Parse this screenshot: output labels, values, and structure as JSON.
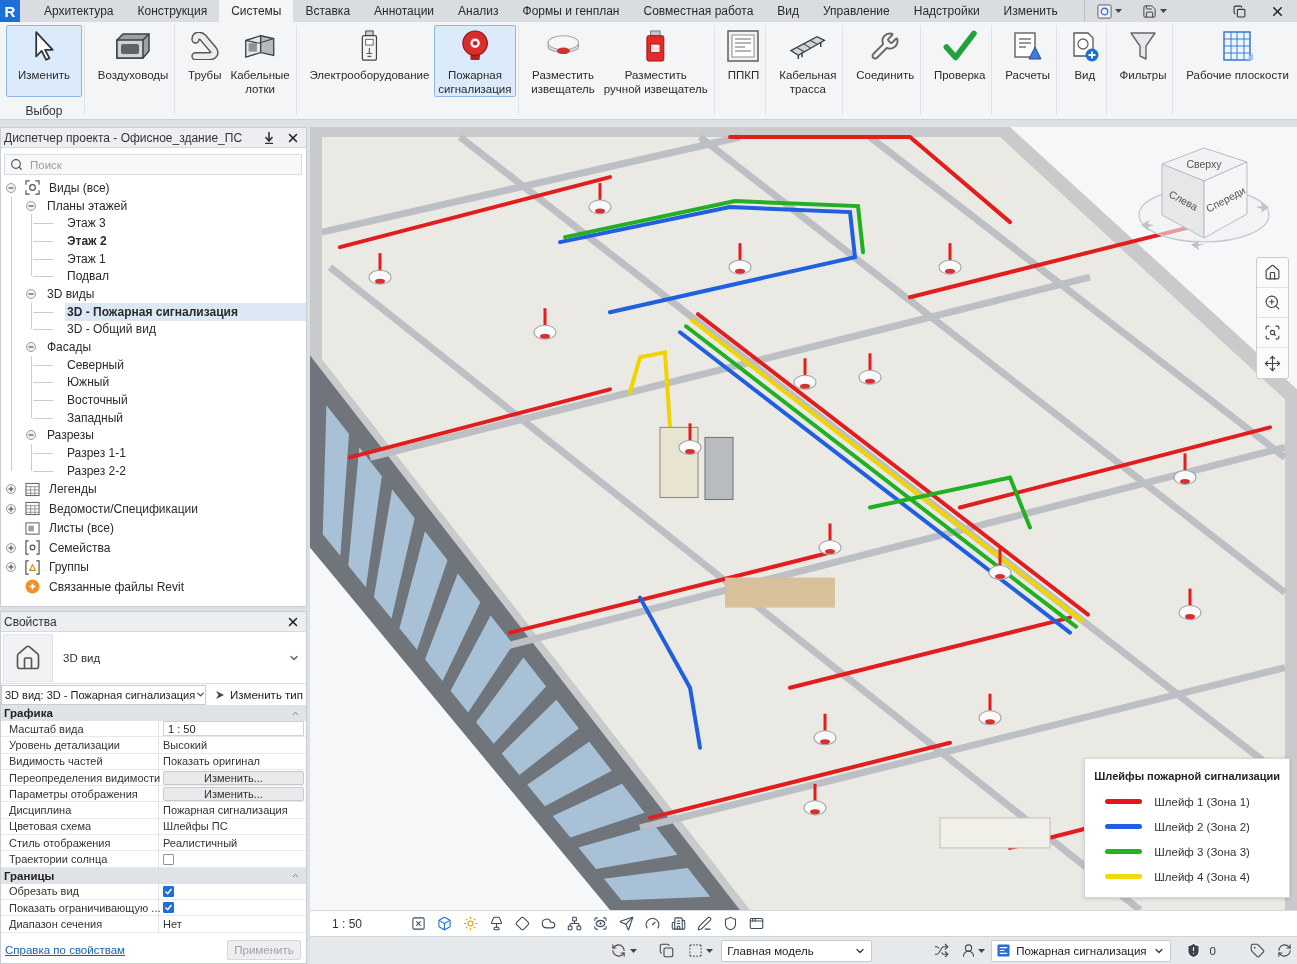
{
  "app": {
    "logo": "R"
  },
  "tabs": [
    {
      "label": "Архитектура",
      "selected": false
    },
    {
      "label": "Конструкция",
      "selected": false
    },
    {
      "label": "Системы",
      "selected": true
    },
    {
      "label": "Вставка",
      "selected": false
    },
    {
      "label": "Аннотации",
      "selected": false
    },
    {
      "label": "Анализ",
      "selected": false
    },
    {
      "label": "Формы и генплан",
      "selected": false
    },
    {
      "label": "Совместная работа",
      "selected": false
    },
    {
      "label": "Вид",
      "selected": false
    },
    {
      "label": "Управление",
      "selected": false
    },
    {
      "label": "Надстройки",
      "selected": false
    },
    {
      "label": "Изменить",
      "selected": false
    }
  ],
  "ribbon": {
    "panels": [
      {
        "label": "Выбор",
        "buttons": [
          {
            "kind": "modify",
            "label": "Изменить",
            "selected": true
          }
        ]
      },
      {
        "buttons": [
          {
            "kind": "duct",
            "label": "Воздуховоды",
            "selected": false
          }
        ]
      },
      {
        "buttons": [
          {
            "kind": "pipe",
            "label": "Трубы",
            "selected": false
          },
          {
            "kind": "tray",
            "label": "Кабельные\nлотки",
            "selected": false
          }
        ]
      },
      {
        "buttons": [
          {
            "kind": "electrical",
            "label": "Электрооборудование",
            "selected": false
          },
          {
            "kind": "alarm",
            "label": "Пожарная\nсигнализация",
            "selected": true
          }
        ]
      },
      {
        "buttons": [
          {
            "kind": "detector",
            "label": "Разместить\nизвещатель",
            "selected": false
          },
          {
            "kind": "callpoint",
            "label": "Разместить\nручной извещатель",
            "selected": false
          }
        ]
      },
      {
        "buttons": [
          {
            "kind": "panel",
            "label": "ППКП",
            "selected": false
          }
        ]
      },
      {
        "buttons": [
          {
            "kind": "route",
            "label": "Кабельная\nтрасса",
            "selected": false
          }
        ]
      },
      {
        "buttons": [
          {
            "kind": "connect",
            "label": "Соединить",
            "selected": false
          }
        ]
      },
      {
        "buttons": [
          {
            "kind": "check",
            "label": "Проверка",
            "selected": false
          }
        ]
      },
      {
        "buttons": [
          {
            "kind": "calc",
            "label": "Расчеты",
            "selected": false
          }
        ]
      },
      {
        "buttons": [
          {
            "kind": "view",
            "label": "Вид",
            "selected": false
          }
        ]
      },
      {
        "buttons": [
          {
            "kind": "filter",
            "label": "Фильтры",
            "selected": false
          }
        ]
      },
      {
        "buttons": [
          {
            "kind": "workplane",
            "label": "Рабочие плоскости",
            "selected": false
          }
        ]
      }
    ]
  },
  "project_browser": {
    "title": "Диспетчер проекта - Офисное_здание_ПС",
    "search": {
      "placeholder": "Поиск"
    },
    "tree": [
      {
        "kind": "views",
        "label": "Виды (все)",
        "expanded": true,
        "selected": false,
        "children": [
          {
            "label": "Планы этажей",
            "expanded": true,
            "selected": false,
            "children": [
              {
                "label": "Этаж 3",
                "selected": false,
                "active": false
              },
              {
                "label": "Этаж 2",
                "selected": false,
                "active": true
              },
              {
                "label": "Этаж 1",
                "selected": false,
                "active": false
              },
              {
                "label": "Подвал",
                "selected": false,
                "active": false
              }
            ]
          },
          {
            "label": "3D виды",
            "expanded": true,
            "selected": false,
            "children": [
              {
                "label": "3D - Пожарная сигнализация",
                "selected": true,
                "active": true
              },
              {
                "label": "3D - Общий вид",
                "selected": false,
                "active": false
              }
            ]
          },
          {
            "label": "Фасады",
            "expanded": true,
            "selected": false,
            "children": [
              {
                "label": "Северный",
                "selected": false,
                "active": false
              },
              {
                "label": "Южный",
                "selected": false,
                "active": false
              },
              {
                "label": "Восточный",
                "selected": false,
                "active": false
              },
              {
                "label": "Западный",
                "selected": false,
                "active": false
              }
            ]
          },
          {
            "label": "Разрезы",
            "expanded": true,
            "selected": false,
            "children": [
              {
                "label": "Разрез 1-1",
                "selected": false,
                "active": false
              },
              {
                "label": "Разрез 2-2",
                "selected": false,
                "active": false
              }
            ]
          }
        ]
      },
      {
        "kind": "legends",
        "label": "Легенды",
        "expanded": false,
        "selected": false
      },
      {
        "kind": "schedules",
        "label": "Ведомости/Спецификации",
        "expanded": false,
        "selected": false
      },
      {
        "kind": "sheets",
        "label": "Листы (все)",
        "selected": false
      },
      {
        "kind": "families",
        "label": "Семейства",
        "expanded": false,
        "selected": false
      },
      {
        "kind": "groups",
        "label": "Группы",
        "expanded": false,
        "selected": false
      },
      {
        "kind": "links",
        "label": "Связанные файлы Revit",
        "selected": false
      }
    ]
  },
  "properties": {
    "title": "Свойства",
    "type_name": "3D вид",
    "instance": "3D вид: 3D - Пожарная сигнализация",
    "edit_type": "Изменить тип",
    "groups": [
      {
        "label": "Графика",
        "expanded": true,
        "rows": [
          {
            "kind": "field",
            "name": "Масштаб вида",
            "value": "1 : 50"
          },
          {
            "kind": "text",
            "name": "Уровень детализации",
            "value": "Высокий"
          },
          {
            "kind": "text",
            "name": "Видимость частей",
            "value": "Показать оригинал"
          },
          {
            "kind": "button",
            "name": "Переопределения видимости",
            "value": "Изменить..."
          },
          {
            "kind": "button",
            "name": "Параметры отображения",
            "value": "Изменить..."
          },
          {
            "kind": "text",
            "name": "Дисциплина",
            "value": "Пожарная сигнализация"
          },
          {
            "kind": "text",
            "name": "Цветовая схема",
            "value": "Шлейфы ПС"
          },
          {
            "kind": "text",
            "name": "Стиль отображения",
            "value": "Реалистичный"
          },
          {
            "kind": "checkbox",
            "name": "Траектории солнца",
            "checked": false
          }
        ]
      },
      {
        "label": "Границы",
        "expanded": true,
        "rows": [
          {
            "kind": "checkbox",
            "name": "Обрезать вид",
            "checked": true
          },
          {
            "kind": "checkbox",
            "name": "Показать ограничивающую ...",
            "checked": true
          },
          {
            "kind": "text",
            "name": "Диапазон сечения",
            "value": "Нет"
          }
        ]
      }
    ],
    "help_link": "Справка по свойствам",
    "apply": {
      "label": "Применить",
      "disabled": true
    }
  },
  "viewport": {
    "view_cube": {
      "top": "Сверху",
      "left": "Слева",
      "front": "Спереди"
    },
    "legend": {
      "title": "Шлейфы пожарной сигнализации",
      "items": [
        {
          "label": "Шлейф 1 (Зона 1)",
          "color": "#e8141b"
        },
        {
          "label": "Шлейф 2 (Зона 2)",
          "color": "#1e5fe6"
        },
        {
          "label": "Шлейф 3 (Зона 3)",
          "color": "#22b522"
        },
        {
          "label": "Шлейф 4 (Зона 4)",
          "color": "#f2d90a"
        }
      ]
    }
  },
  "view_bar": {
    "scale": "1 : 50"
  },
  "status_bar": {
    "workset": "Главная модель",
    "view_filter": "Пожарная сигнализация",
    "warnings": "0"
  }
}
